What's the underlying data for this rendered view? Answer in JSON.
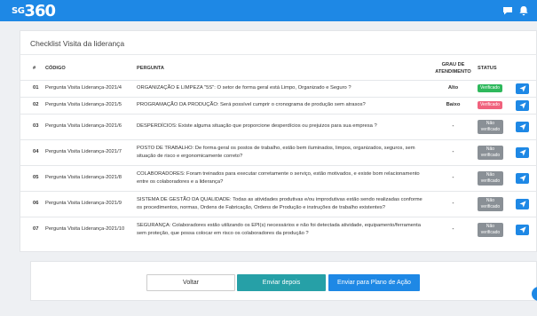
{
  "app": {
    "logo_prefix": "SG",
    "logo_number": "360"
  },
  "colors": {
    "topbar": "#1e88e5",
    "verified": "#2eb85c",
    "failed": "#f0627d",
    "not_verified": "#8a9096",
    "primary": "#1e88e5",
    "teal": "#26a0a7"
  },
  "checklist": {
    "title": "Checklist Visita da liderança",
    "headers": {
      "num": "#",
      "code": "CÓDIGO",
      "question": "PERGUNTA",
      "grade_line1": "GRAU DE",
      "grade_line2": "ATENDIMENTO",
      "status": "STATUS"
    },
    "rows": [
      {
        "num": "01",
        "code": "Pergunta Visita Liderança-2021/4",
        "question": "ORGANIZAÇÃO E LIMPEZA \"5S\": O setor de forma geral está Limpo, Organizado e Seguro ?",
        "grade": "Alto",
        "status": "Verificado",
        "status_type": "ok"
      },
      {
        "num": "02",
        "code": "Pergunta Visita Liderança-2021/5",
        "question": "PROGRAMAÇÃO DA PRODUÇÃO: Será possível cumprir o cronograma de produção sem atrasos?",
        "grade": "Baixo",
        "status": "Verificado",
        "status_type": "bad"
      },
      {
        "num": "03",
        "code": "Pergunta Visita Liderança-2021/6",
        "question": "DESPERDÍCIOS: Existe alguma situação que proporcione desperdícios ou prejuizos para sua empresa ?",
        "grade": "-",
        "status": "Não verificado",
        "status_type": "no"
      },
      {
        "num": "04",
        "code": "Pergunta Visita Liderança-2021/7",
        "question": "POSTO DE TRABALHO: De forma geral os postos de trabalho, estão bem iluminados, limpos, organizados, seguros, sem situação de risco e ergonomicamente correto?",
        "grade": "-",
        "status": "Não verificado",
        "status_type": "no"
      },
      {
        "num": "05",
        "code": "Pergunta Visita Liderança-2021/8",
        "question": "COLABORADORES: Foram treinados para executar corretamente o serviço, estão motivados, e existe bom relacionamento entre os colaboradores e a liderança?",
        "grade": "-",
        "status": "Não verificado",
        "status_type": "no"
      },
      {
        "num": "06",
        "code": "Pergunta Visita Liderança-2021/9",
        "question": "SISTEMA DE GESTÃO DA QUALIDADE: Todas as atividades produtivas e/ou improdutivas estão sendo realizadas conforme os procedimentos, normas, Ordens de Fabricação, Ordens de Produção e instruções de trabalho existentes?",
        "grade": "-",
        "status": "Não verificado",
        "status_type": "no"
      },
      {
        "num": "07",
        "code": "Pergunta Visita Liderança-2021/10",
        "question": "SEGURANÇA: Colaboradores estão utilizando os EPI(s) necessários e não foi detectada atividade, equipamento/ferramenta sem proteção, que possa colocar em risco os colaboradores da produção ?",
        "grade": "-",
        "status": "Não verificado",
        "status_type": "no"
      }
    ]
  },
  "actions": {
    "back": "Voltar",
    "send_later": "Enviar depois",
    "send_plan": "Enviar para Plano de Ação"
  }
}
